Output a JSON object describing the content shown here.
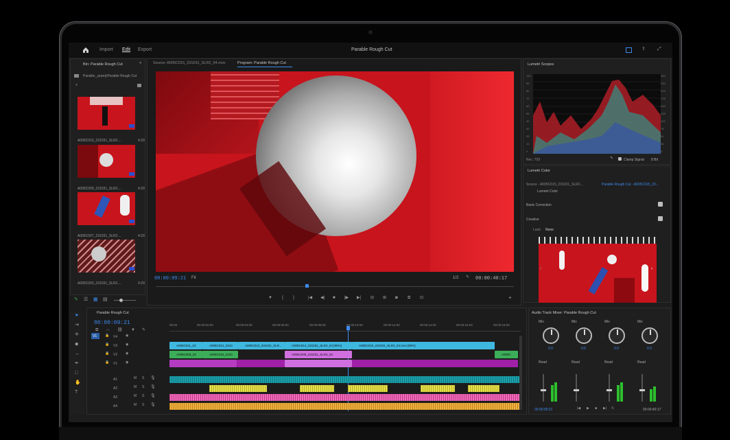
{
  "app": {
    "title": "Parable Rough Cut",
    "tabs": [
      "Import",
      "Edit",
      "Export"
    ]
  },
  "bin": {
    "header": "Bin: Parable Rough Cut",
    "path": "Parable_.prproj\\Parable Rough Cut",
    "items": [
      {
        "name": "A005C010_231031_SLR2....",
        "duration": "4:29"
      },
      {
        "name": "A005C009_231031_SLR2....",
        "duration": "4:29"
      },
      {
        "name": "A005C007_231031_SLR2....",
        "duration": "4:29"
      },
      {
        "name": "A005C003_231031_SLR2....",
        "duration": "4:29"
      }
    ]
  },
  "monitor": {
    "source_tab": "Source: A005C015_231031_SLR2_04.mov",
    "program_tab": "Program: Parable Rough Cut",
    "timecode": "00:00:09:21",
    "fit": "Fit",
    "scale": "1/2",
    "duration": "00:00:40:17"
  },
  "scopes": {
    "header": "Lumetri Scopes",
    "left_ticks": [
      "100",
      "90",
      "80",
      "70",
      "60",
      "50",
      "40",
      "30",
      "20",
      "10",
      "0"
    ],
    "right_ticks": [
      "255",
      "230",
      "204",
      "178",
      "153",
      "128",
      "102",
      "76",
      "51",
      "26",
      "0"
    ],
    "standard": "Rec. 709",
    "clamp_label": "Clamp Signal",
    "bit_depth": "8 Bit"
  },
  "lumetri": {
    "header": "Lumetri Color",
    "source": "Source - A005C015_231031_SLR2...",
    "target": "Parable Rough Cut - A005C015_23...",
    "effect": "Lumetri Color",
    "basic": "Basic Correction",
    "creative": "Creative",
    "look_label": "Look",
    "look_value": "None"
  },
  "timeline": {
    "header": "Parable Rough Cut",
    "timecode": "00:00:09:21",
    "ruler": [
      "00:00",
      "00:00:02:00",
      "00:00:04:00",
      "00:00:06:00",
      "00:00:08:00",
      "00:00:10:00",
      "00:00:12:00",
      "00:00:14:00",
      "00:00:16:00",
      "00:00:18:00"
    ],
    "video_tracks": [
      "V4",
      "V3",
      "V2",
      "V1"
    ],
    "audio_tracks": [
      "A1",
      "A2",
      "A3",
      "A4"
    ],
    "source_patch": "V1",
    "clips_v3": [
      {
        "label": "A005C011_23",
        "color": "#3fb8e0"
      },
      {
        "label": "A005C012_2310",
        "color": "#3fb8e0"
      },
      {
        "label": "A005C013_231031_SLR...",
        "color": "#3fb8e0"
      },
      {
        "label": "A005C014_231031_SLR2_04 [90%]",
        "color": "#3fb8e0"
      },
      {
        "label": "A005C015_231031_SLR2_04.mov [90%]",
        "color": "#3fb8e0"
      }
    ],
    "clips_v2": [
      {
        "label": "A005C008_23",
        "color": "#3cae5a"
      },
      {
        "label": "A005C010_2310",
        "color": "#3cae5a"
      },
      {
        "label": "A005C009_231031_SLR2_04",
        "color": "#d070e0"
      },
      {
        "label": "A005C",
        "color": "#3cae5a"
      }
    ]
  },
  "mixer": {
    "header": "Audio Track Mixer: Parable Rough Cut",
    "channels": [
      {
        "mix": "Mix",
        "value": "0.0",
        "mode": "Read"
      },
      {
        "mix": "Mix",
        "value": "0.0",
        "mode": "Read"
      },
      {
        "mix": "Mix",
        "value": "0.0",
        "mode": "Read"
      },
      {
        "mix": "Mix",
        "value": "0.0",
        "mode": "Read"
      }
    ],
    "timecode": "00:00:09:21",
    "duration": "00:00:40:17"
  }
}
